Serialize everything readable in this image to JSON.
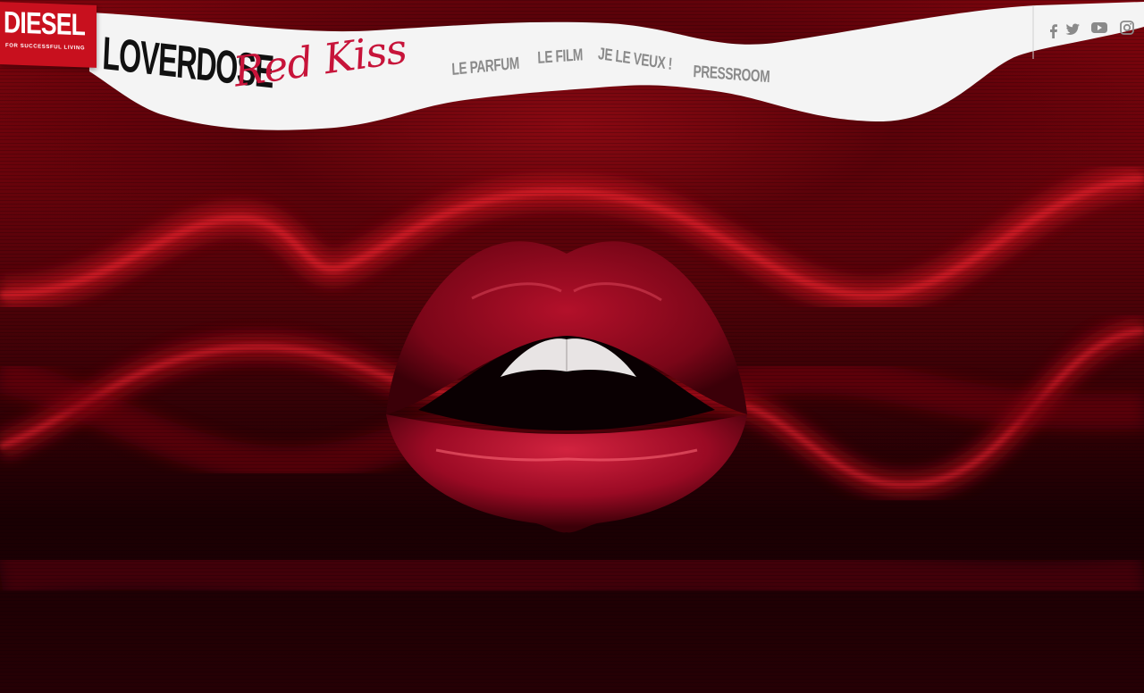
{
  "brand": {
    "diesel_word": "DIESEL",
    "diesel_tagline": "FOR SUCCESSFUL LIVING",
    "product_name": "LOVERDOSE",
    "product_sub": "Red Kiss"
  },
  "nav": {
    "items": [
      {
        "label": "LE PARFUM"
      },
      {
        "label": "LE FILM"
      },
      {
        "label": "JE LE VEUX !"
      },
      {
        "label": "PRESSROOM"
      }
    ]
  },
  "social": {
    "icons": [
      "facebook-icon",
      "twitter-icon",
      "youtube-icon",
      "instagram-icon"
    ]
  },
  "colors": {
    "accent_red": "#c8101e",
    "script_pink": "#c7143a",
    "nav_grey": "#8a8a8a",
    "band_white": "#f4f4f4"
  },
  "hero": {
    "image_subject": "red-lips"
  }
}
